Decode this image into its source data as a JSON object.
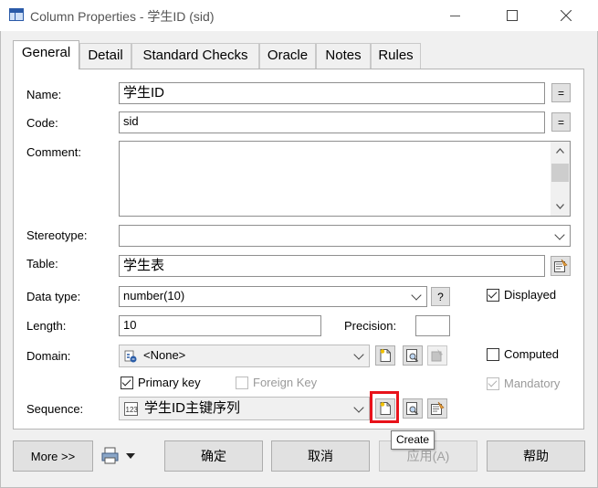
{
  "window": {
    "title": "Column Properties - 学生ID (sid)"
  },
  "tabs": [
    "General",
    "Detail",
    "Standard Checks",
    "Oracle",
    "Notes",
    "Rules"
  ],
  "form": {
    "name_label": "Name:",
    "name_value": "学生ID",
    "name_eq": "=",
    "code_label": "Code:",
    "code_value": "sid",
    "code_eq": "=",
    "comment_label": "Comment:",
    "comment_value": "",
    "stereotype_label": "Stereotype:",
    "stereotype_value": "",
    "table_label": "Table:",
    "table_value": "学生表",
    "datatype_label": "Data type:",
    "datatype_value": "number(10)",
    "datatype_help": "?",
    "displayed_label": "Displayed",
    "displayed_checked": true,
    "length_label": "Length:",
    "length_value": "10",
    "precision_label": "Precision:",
    "precision_value": "",
    "domain_label": "Domain:",
    "domain_value": "<None>",
    "computed_label": "Computed",
    "computed_checked": false,
    "primary_key_label": "Primary key",
    "primary_key_checked": true,
    "foreign_key_label": "Foreign Key",
    "foreign_key_checked": false,
    "mandatory_label": "Mandatory",
    "mandatory_checked": true,
    "sequence_label": "Sequence:",
    "sequence_value": "学生ID主键序列"
  },
  "tooltip": "Create",
  "buttons": {
    "more": "More >>",
    "ok": "确定",
    "cancel": "取消",
    "apply": "应用(A)",
    "help": "帮助"
  },
  "colors": {
    "highlight": "#e8121a"
  }
}
